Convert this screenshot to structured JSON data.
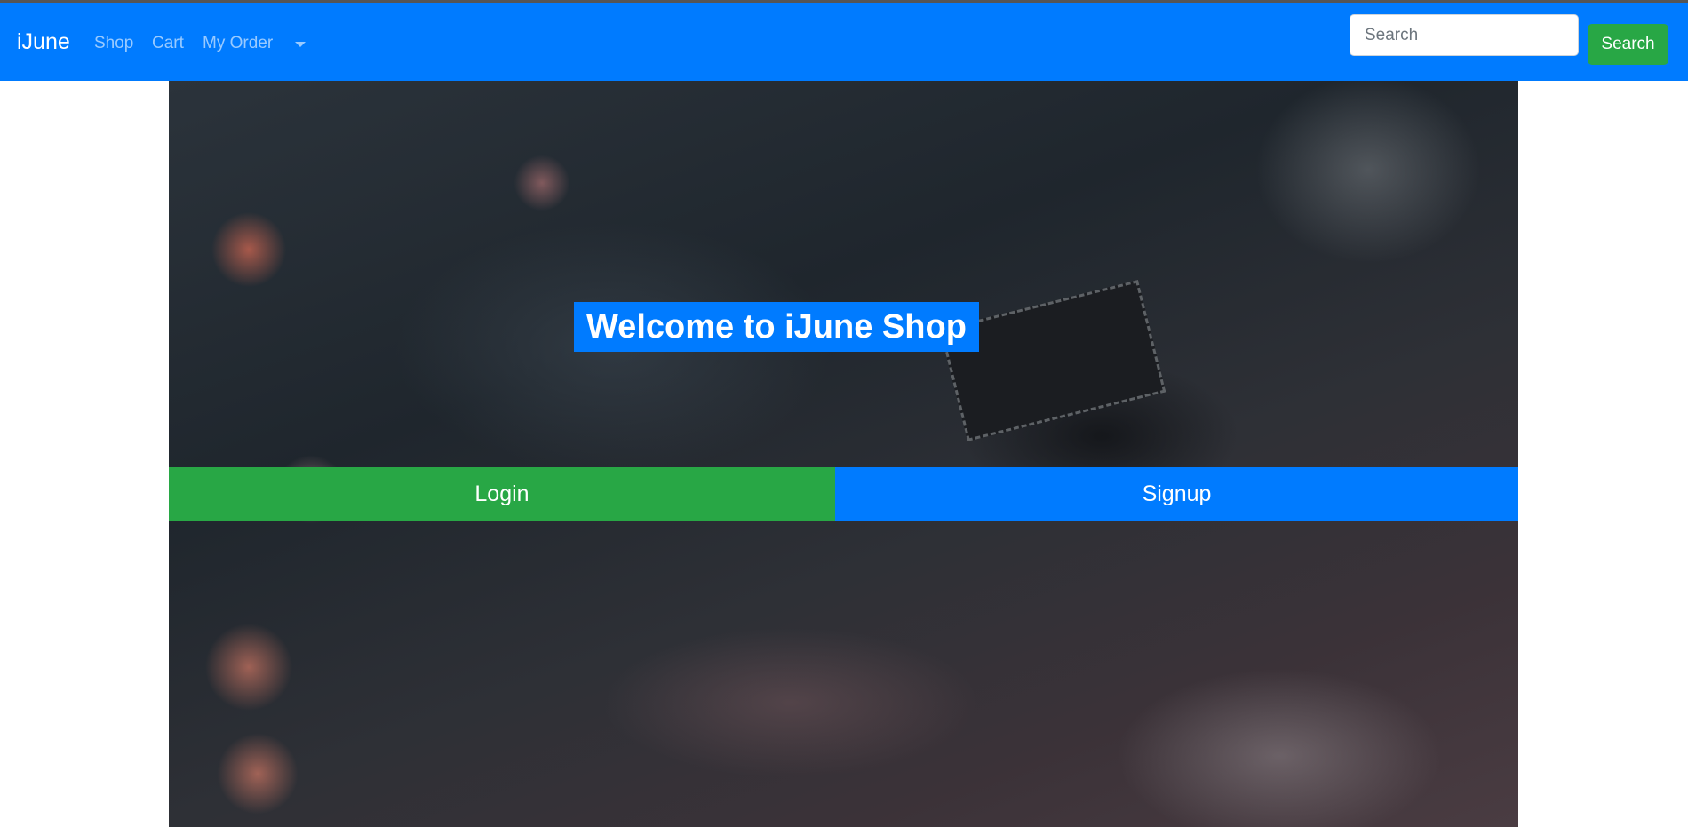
{
  "navbar": {
    "brand": "iJune",
    "links": [
      "Shop",
      "Cart",
      "My Order"
    ],
    "dropdown_icon": "caret-down-icon",
    "search_placeholder": "Search",
    "search_button": "Search"
  },
  "hero": {
    "background_image": "circuit-board-photo",
    "title": "Welcome to iJune Shop",
    "login_label": "Login",
    "signup_label": "Signup"
  },
  "colors": {
    "primary": "#007bff",
    "success": "#28a745"
  }
}
